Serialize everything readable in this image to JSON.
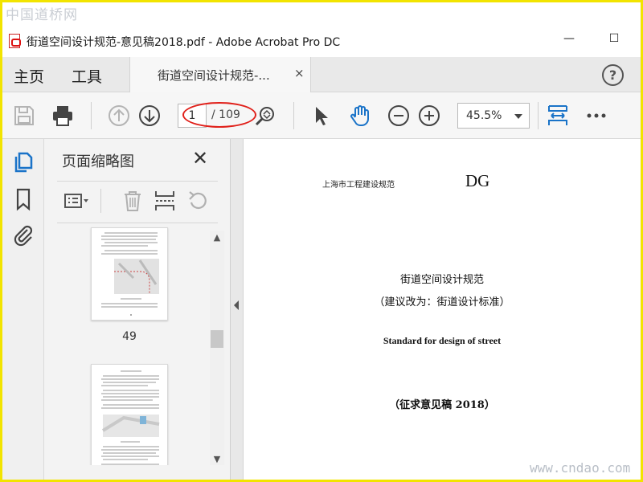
{
  "watermark_top": "中国道桥网",
  "watermark_bottom": "www.cndao.com",
  "window": {
    "title": "街道空间设计规范-意见稿2018.pdf - Adobe Acrobat Pro DC",
    "minimize": "—",
    "maximize": "☐"
  },
  "tabs": {
    "home": "主页",
    "tools": "工具",
    "doc_tab": "街道空间设计规范-...",
    "doc_tab_close": "×",
    "help": "?"
  },
  "toolbar": {
    "page_current": "1",
    "page_total": "/ 109",
    "zoom": "45.5%"
  },
  "panel": {
    "title": "页面缩略图",
    "close": "✕",
    "thumbnail_page_number": "49"
  },
  "document": {
    "header_left": "上海市工程建设规范",
    "code": "DG",
    "title": "街道空间设计规范",
    "subtitle": "（建议改为：街道设计标准）",
    "english_title": "Standard for design of street",
    "draft_note": "（征求意见稿 2018）"
  },
  "colors": {
    "accent_blue": "#1a73c8",
    "annotation_red": "#e0201a",
    "frame_yellow": "#f2e400"
  },
  "icons": {
    "save": "save-icon",
    "print": "print-icon",
    "prev_page": "arrow-up-circle-icon",
    "next_page": "arrow-down-circle-icon",
    "find": "magnifier-icon",
    "select": "cursor-arrow-icon",
    "hand": "hand-tool-icon",
    "zoom_out": "zoom-out-icon",
    "zoom_in": "zoom-in-icon",
    "fit": "fit-page-icon",
    "more": "more-icon"
  }
}
